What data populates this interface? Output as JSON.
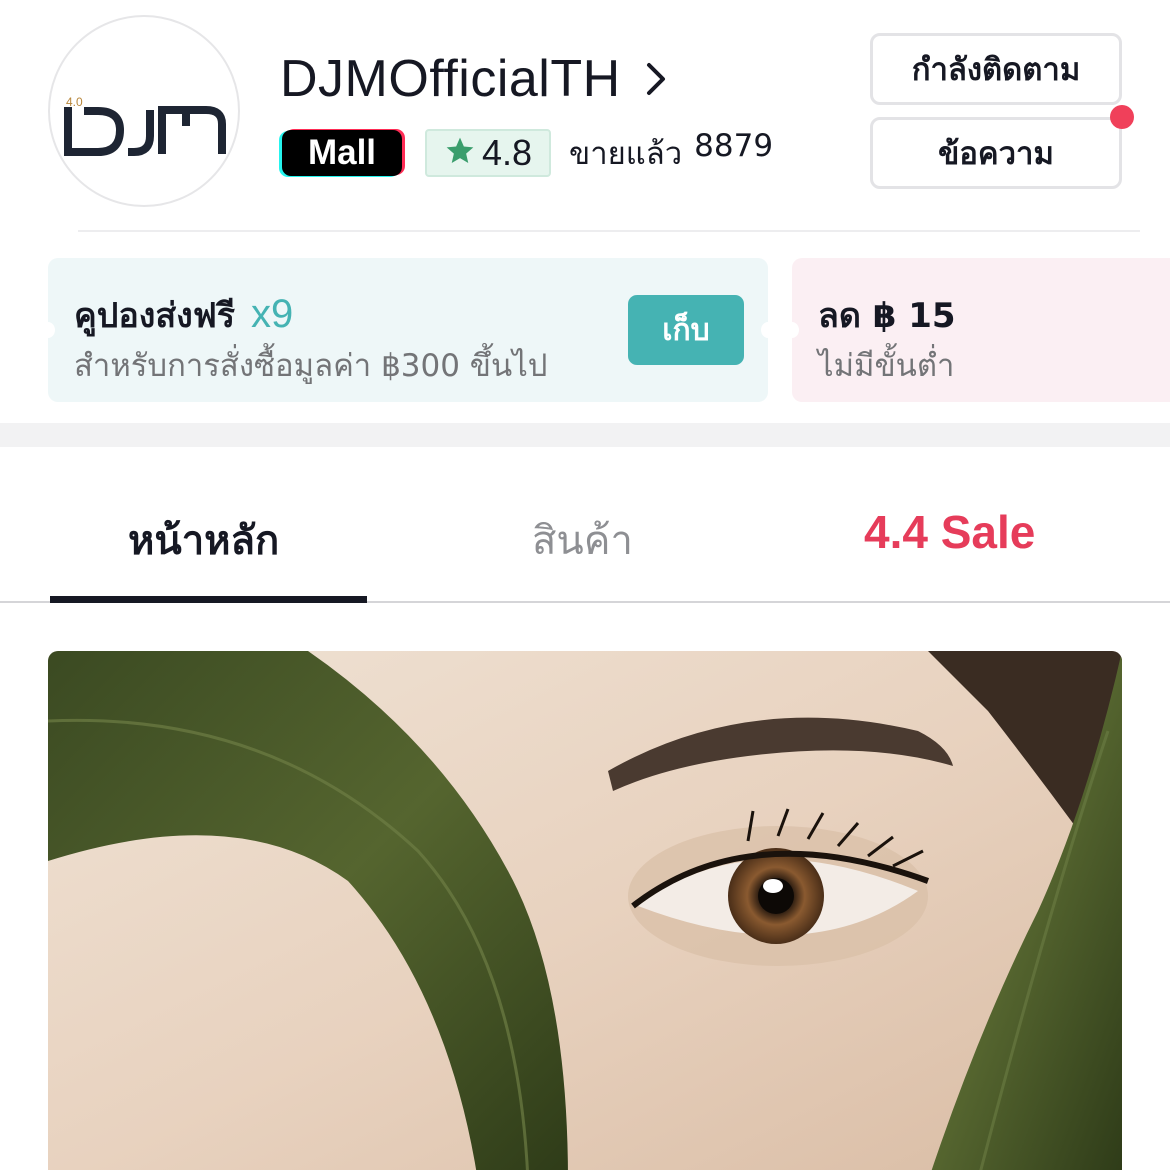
{
  "shop": {
    "name": "DJMOfficialTH",
    "logo_text": "DJM",
    "logo_version": "4.0",
    "mall_badge": "Mall",
    "rating": "4.8",
    "sold_label": "ขายแล้ว",
    "sold_count": "8879"
  },
  "actions": {
    "following_label": "กำลังติดตาม",
    "message_label": "ข้อความ",
    "message_unread_dot": true
  },
  "coupons": [
    {
      "title": "คูปองส่งฟรี",
      "multiplier": "x9",
      "subtitle": "สำหรับการสั่งซื้อมูลค่า ฿300 ขึ้นไป",
      "button_label": "เก็บ"
    },
    {
      "title": "ลด ฿ 15",
      "subtitle": "ไม่มีขั้นต่ำ"
    }
  ],
  "tabs": [
    {
      "label": "หน้าหลัก",
      "active": true
    },
    {
      "label": "สินค้า",
      "active": false
    },
    {
      "label": "4.4 Sale",
      "active": false
    }
  ],
  "colors": {
    "teal_accent": "#45b3b3",
    "sale_red": "#e63c5a",
    "notification_dot": "#f0405a",
    "text_primary": "#161823"
  },
  "icons": {
    "name_chevron": "chevron-right-icon",
    "rating_star": "star-icon"
  }
}
